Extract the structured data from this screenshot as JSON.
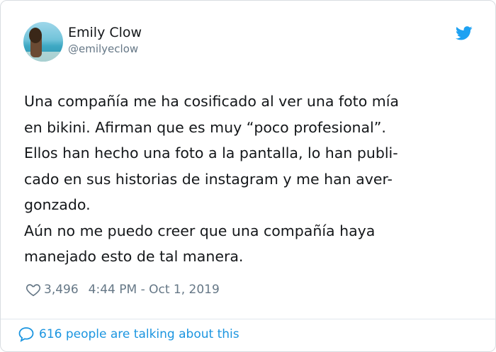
{
  "user": {
    "name": "Emily Clow",
    "handle": "@emilyeclow"
  },
  "tweet": {
    "text": "Una compañía me ha cosificado al ver una foto mía\nen bikini. Afirman que es muy “poco profesional”.\nEllos han hecho una foto a la pantalla, lo han publi-\ncado en sus historias de instagram y me han aver-\ngonzado.\nAún no me puedo creer que una compañía haya\nmanejado esto de tal manera.",
    "likes": "3,496",
    "timestamp": "4:44 PM - Oct 1, 2019"
  },
  "footer": {
    "talking_label": "616 people are talking about this"
  },
  "icons": {
    "brand": "twitter-bird-icon",
    "like": "heart-icon",
    "comment": "speech-bubble-icon"
  },
  "colors": {
    "brand_blue": "#1da1f2",
    "link_blue": "#1b95e0",
    "secondary_text": "#657786"
  }
}
